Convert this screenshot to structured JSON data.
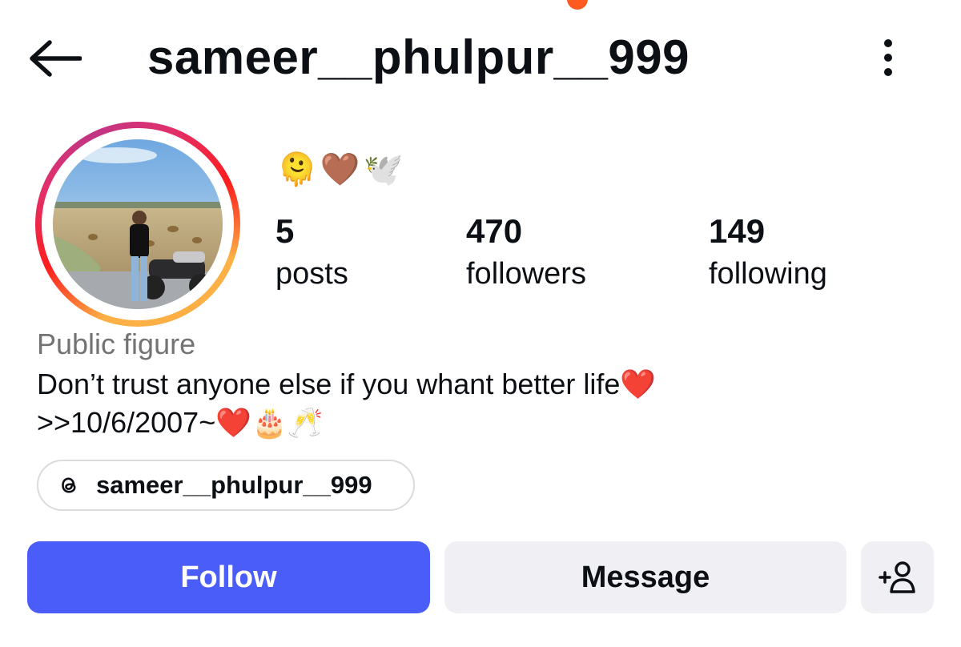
{
  "header": {
    "username": "sameer__phulpur__999",
    "back_icon": "arrow-left-icon",
    "more_icon": "more-vertical-icon"
  },
  "profile": {
    "emoji_line": "🫠🤎🕊️",
    "stats": [
      {
        "count": "5",
        "label": "posts"
      },
      {
        "count": "470",
        "label": "followers"
      },
      {
        "count": "149",
        "label": "following"
      }
    ],
    "category": "Public figure",
    "bio_line1": "Don’t trust anyone else if you whant better life❤️",
    "bio_line2": ">>10/6/2007~❤️🎂🥂",
    "threads_handle": "sameer__phulpur__999",
    "threads_icon": "threads-icon"
  },
  "actions": {
    "follow_label": "Follow",
    "message_label": "Message",
    "add_friend_icon": "add-person-icon"
  },
  "colors": {
    "follow_button": "#4a5df9",
    "secondary_button": "#efeff4",
    "category_text": "#737373",
    "notification_dot": "#ff5a1f"
  }
}
